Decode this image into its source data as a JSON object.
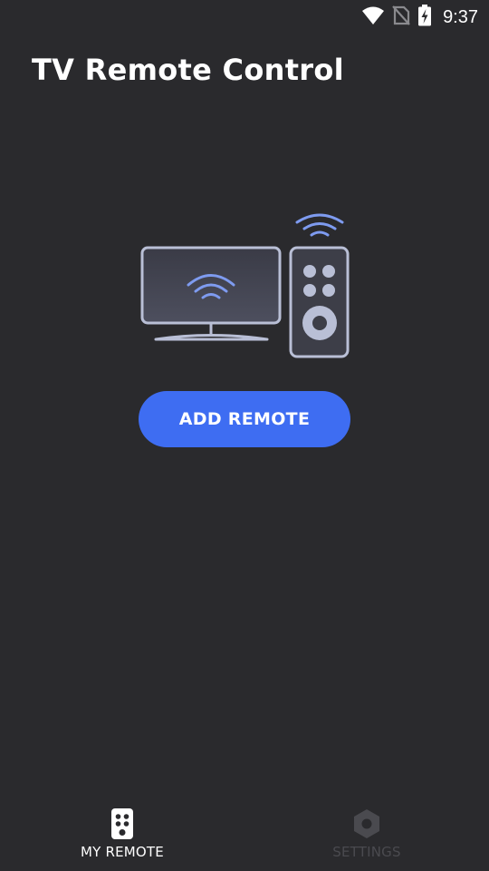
{
  "status_bar": {
    "time": "9:37",
    "icons": [
      "wifi-icon",
      "no-sim-icon",
      "battery-charging-icon"
    ]
  },
  "header": {
    "title": "TV Remote Control"
  },
  "main": {
    "illustration": "tv-and-remote-illustration",
    "add_button_label": "ADD REMOTE"
  },
  "bottom_nav": {
    "items": [
      {
        "label": "MY REMOTE",
        "icon": "remote-icon",
        "active": true
      },
      {
        "label": "SETTINGS",
        "icon": "settings-hex-icon",
        "active": false
      }
    ]
  },
  "colors": {
    "background": "#2a2a2d",
    "accent": "#3e6df2",
    "illustration_stroke": "#b9bfd6",
    "wifi_blue": "#7e9bf0",
    "inactive": "#4a4a4f"
  }
}
